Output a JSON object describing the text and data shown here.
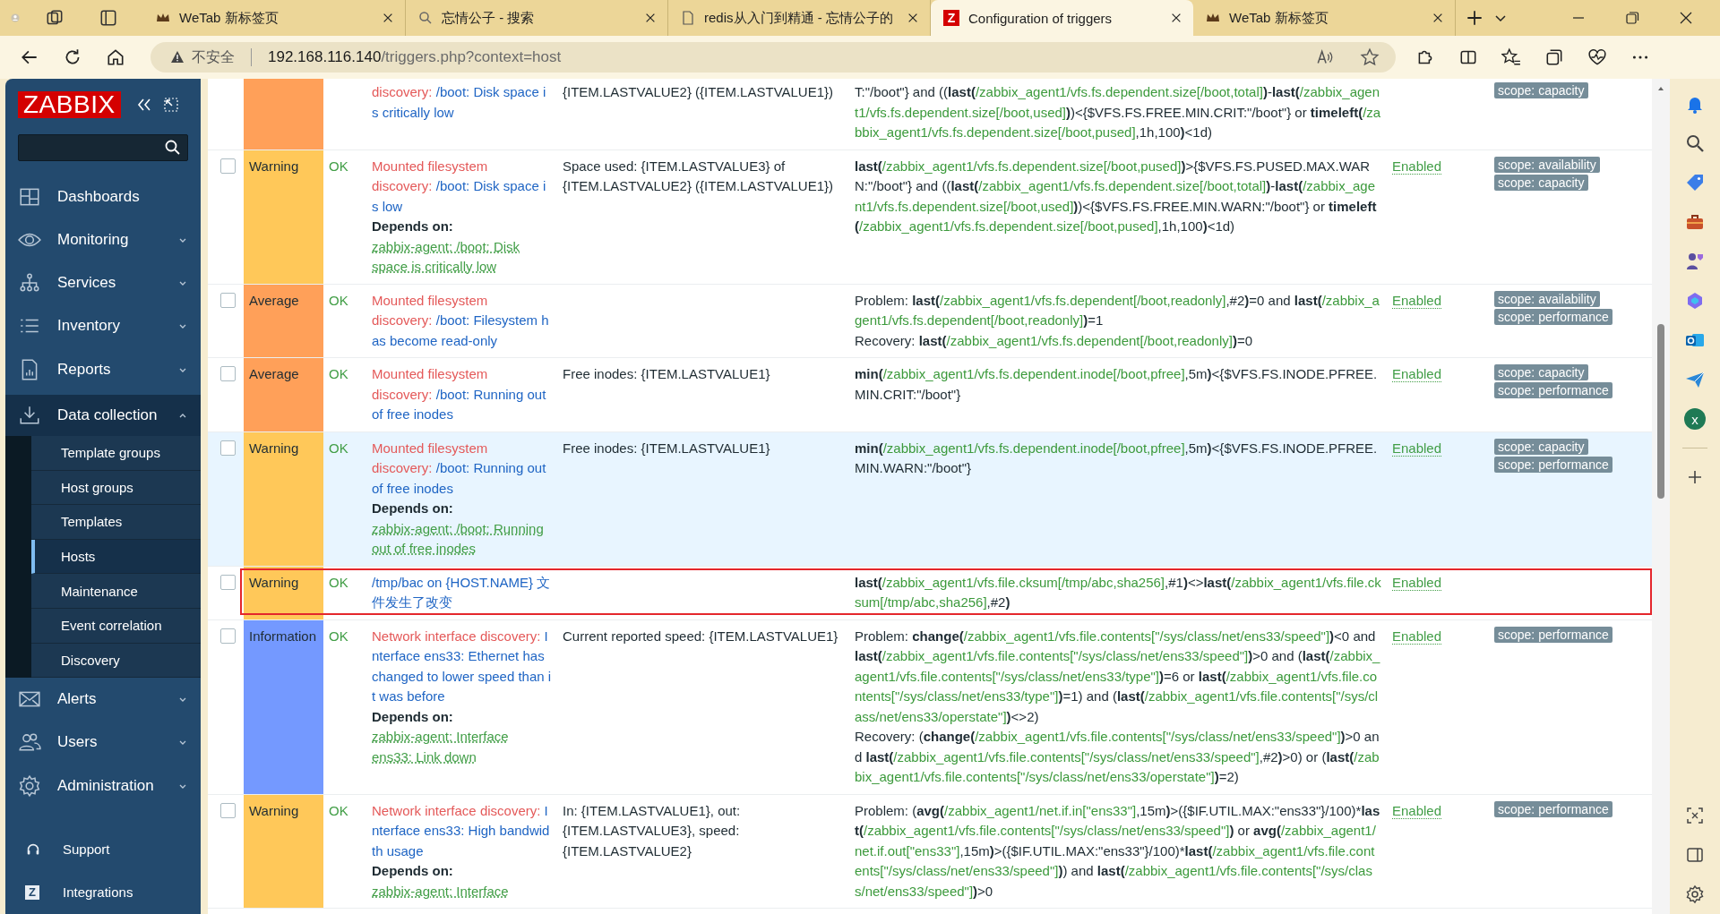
{
  "browser": {
    "tabs": [
      {
        "title": "WeTab 新标签页",
        "selected": false
      },
      {
        "title": "忘情公子 - 搜索",
        "selected": false
      },
      {
        "title": "redis从入门到精通 - 忘情公子的",
        "selected": false
      },
      {
        "title": "Configuration of triggers",
        "icon_letter": "Z",
        "selected": true
      },
      {
        "title": "WeTab 新标签页",
        "selected": false
      }
    ],
    "address": {
      "warning": "不安全",
      "host": "192.168.116.140",
      "path": "/triggers.php?context=host"
    },
    "side_badge": "x"
  },
  "sidebar": {
    "logo": "ZABBIX",
    "items": [
      {
        "label": "Dashboards",
        "kind": "link"
      },
      {
        "label": "Monitoring",
        "kind": "group",
        "expanded": false
      },
      {
        "label": "Services",
        "kind": "group",
        "expanded": false
      },
      {
        "label": "Inventory",
        "kind": "group",
        "expanded": false
      },
      {
        "label": "Reports",
        "kind": "group",
        "expanded": false
      },
      {
        "label": "Data collection",
        "kind": "group",
        "expanded": true,
        "children": [
          {
            "label": "Template groups",
            "selected": false
          },
          {
            "label": "Host groups",
            "selected": false
          },
          {
            "label": "Templates",
            "selected": false
          },
          {
            "label": "Hosts",
            "selected": true
          },
          {
            "label": "Maintenance",
            "selected": false
          },
          {
            "label": "Event correlation",
            "selected": false
          },
          {
            "label": "Discovery",
            "selected": false
          }
        ]
      },
      {
        "label": "Alerts",
        "kind": "group",
        "expanded": false
      },
      {
        "label": "Users",
        "kind": "group",
        "expanded": false
      },
      {
        "label": "Administration",
        "kind": "group",
        "expanded": false
      }
    ],
    "footer_items": [
      {
        "label": "Support"
      },
      {
        "label": "Integrations",
        "icon_letter": "Z"
      }
    ]
  },
  "table": {
    "rows": [
      {
        "color": "#ffa059",
        "highlighted": false,
        "outlined": false,
        "name_prefix": "discovery:",
        "name": "/boot: Disk space is critically low",
        "opdata": "{ITEM.LASTVALUE2} ({ITEM.LASTVALUE1})",
        "expression": [
          [
            {
              "kind": "text",
              "text": "T:\"/boot\"} and (("
            },
            {
              "kind": "fn",
              "text": "last("
            },
            {
              "kind": "item",
              "text": "/zabbix_agent1/vfs.fs.dependent.size[/boot,total]"
            },
            {
              "kind": "fn",
              "text": ")"
            },
            {
              "kind": "text",
              "text": "-"
            },
            {
              "kind": "fn",
              "text": "last("
            },
            {
              "kind": "item",
              "text": "/zabbix_agent1/vfs.fs.dependent.size[/boot,used]"
            },
            {
              "kind": "fn",
              "text": ")"
            },
            {
              "kind": "text",
              "text": ")<{$VFS.FS.FREE.MIN.CRIT:\"/boot\"} or "
            },
            {
              "kind": "fn",
              "text": "timeleft("
            },
            {
              "kind": "item",
              "text": "/zabbix_agent1/vfs.fs.dependent.size[/boot,pused]"
            },
            {
              "kind": "text",
              "text": ",1h,100"
            },
            {
              "kind": "fn",
              "text": ")"
            },
            {
              "kind": "text",
              "text": "<1d)"
            }
          ]
        ],
        "tags": [
          "scope: capacity"
        ]
      },
      {
        "checked": false,
        "color": "#ffc859",
        "severity_label": "Warning",
        "status": "OK",
        "highlighted": false,
        "outlined": false,
        "name_prefix": "Mounted filesystem discovery:",
        "name": "/boot: Disk space is low",
        "depends_label": "Depends on:",
        "depends": [
          "zabbix-agent: /boot: Disk space is critically low"
        ],
        "opdata": "Space used: {ITEM.LASTVALUE3} of {ITEM.LASTVALUE2} ({ITEM.LASTVALUE1})",
        "expression": [
          [
            {
              "kind": "fn",
              "text": "last("
            },
            {
              "kind": "item",
              "text": "/zabbix_agent1/vfs.fs.dependent.size[/boot,pused]"
            },
            {
              "kind": "fn",
              "text": ")"
            },
            {
              "kind": "text",
              "text": ">{$VFS.FS.PUSED.MAX.WARN:\"/boot\"} and (("
            },
            {
              "kind": "fn",
              "text": "last("
            },
            {
              "kind": "item",
              "text": "/zabbix_agent1/vfs.fs.dependent.size[/boot,total]"
            },
            {
              "kind": "fn",
              "text": ")"
            },
            {
              "kind": "text",
              "text": "-"
            },
            {
              "kind": "fn",
              "text": "last("
            },
            {
              "kind": "item",
              "text": "/zabbix_agent1/vfs.fs.dependent.size[/boot,used]"
            },
            {
              "kind": "fn",
              "text": ")"
            },
            {
              "kind": "text",
              "text": ")<{$VFS.FS.FREE.MIN.WARN:\"/boot\"} or "
            },
            {
              "kind": "fn",
              "text": "timeleft("
            },
            {
              "kind": "item",
              "text": "/zabbix_agent1/vfs.fs.dependent.size[/boot,pused]"
            },
            {
              "kind": "text",
              "text": ",1h,100"
            },
            {
              "kind": "fn",
              "text": ")"
            },
            {
              "kind": "text",
              "text": "<1d)"
            }
          ]
        ],
        "state": "Enabled",
        "tags": [
          "scope: availability",
          "scope: capacity"
        ]
      },
      {
        "checked": false,
        "color": "#ffa059",
        "severity_label": "Average",
        "status": "OK",
        "highlighted": false,
        "outlined": false,
        "name_prefix": "Mounted filesystem discovery:",
        "name": "/boot: Filesystem has become read-only",
        "expression": [
          [
            {
              "kind": "text",
              "text": "Problem: "
            },
            {
              "kind": "fn",
              "text": "last("
            },
            {
              "kind": "item",
              "text": "/zabbix_agent1/vfs.fs.dependent[/boot,readonly]"
            },
            {
              "kind": "text",
              "text": ",#2"
            },
            {
              "kind": "fn",
              "text": ")"
            },
            {
              "kind": "text",
              "text": "=0 and "
            },
            {
              "kind": "fn",
              "text": "last("
            },
            {
              "kind": "item",
              "text": "/zabbix_agent1/vfs.fs.dependent[/boot,readonly]"
            },
            {
              "kind": "fn",
              "text": ")"
            },
            {
              "kind": "text",
              "text": "=1"
            }
          ],
          [
            {
              "kind": "text",
              "text": "Recovery: "
            },
            {
              "kind": "fn",
              "text": "last("
            },
            {
              "kind": "item",
              "text": "/zabbix_agent1/vfs.fs.dependent[/boot,readonly]"
            },
            {
              "kind": "fn",
              "text": ")"
            },
            {
              "kind": "text",
              "text": "=0"
            }
          ]
        ],
        "state": "Enabled",
        "tags": [
          "scope: availability",
          "scope: performance"
        ]
      },
      {
        "checked": false,
        "color": "#ffa059",
        "severity_label": "Average",
        "status": "OK",
        "highlighted": false,
        "outlined": false,
        "name_prefix": "Mounted filesystem discovery:",
        "name": "/boot: Running out of free inodes",
        "opdata": "Free inodes: {ITEM.LASTVALUE1}",
        "expression": [
          [
            {
              "kind": "fn",
              "text": "min("
            },
            {
              "kind": "item",
              "text": "/zabbix_agent1/vfs.fs.dependent.inode[/boot,pfree]"
            },
            {
              "kind": "text",
              "text": ",5m"
            },
            {
              "kind": "fn",
              "text": ")"
            },
            {
              "kind": "text",
              "text": "<{$VFS.FS.INODE.PFREE.MIN.CRIT:\"/boot\"}"
            }
          ]
        ],
        "state": "Enabled",
        "tags": [
          "scope: capacity",
          "scope: performance"
        ]
      },
      {
        "checked": false,
        "color": "#ffc859",
        "severity_label": "Warning",
        "status": "OK",
        "highlighted": true,
        "outlined": false,
        "name_prefix": "Mounted filesystem discovery:",
        "name": "/boot: Running out of free inodes",
        "depends_label": "Depends on:",
        "depends": [
          "zabbix-agent: /boot: Running out of free inodes"
        ],
        "opdata": "Free inodes: {ITEM.LASTVALUE1}",
        "expression": [
          [
            {
              "kind": "fn",
              "text": "min("
            },
            {
              "kind": "item",
              "text": "/zabbix_agent1/vfs.fs.dependent.inode[/boot,pfree]"
            },
            {
              "kind": "text",
              "text": ",5m"
            },
            {
              "kind": "fn",
              "text": ")"
            },
            {
              "kind": "text",
              "text": "<{$VFS.FS.INODE.PFREE.MIN.WARN:\"/boot\"}"
            }
          ]
        ],
        "state": "Enabled",
        "tags": [
          "scope: capacity",
          "scope: performance"
        ]
      },
      {
        "checked": false,
        "color": "#ffc859",
        "severity_label": "Warning",
        "status": "OK",
        "highlighted": false,
        "outlined": true,
        "name": "/tmp/bac on {HOST.NAME} 文件发生了改变",
        "expression": [
          [
            {
              "kind": "fn",
              "text": "last("
            },
            {
              "kind": "item",
              "text": "/zabbix_agent1/vfs.file.cksum[/tmp/abc,sha256]"
            },
            {
              "kind": "text",
              "text": ",#1"
            },
            {
              "kind": "fn",
              "text": ")"
            },
            {
              "kind": "text",
              "text": "<>"
            },
            {
              "kind": "fn",
              "text": "last("
            },
            {
              "kind": "item",
              "text": "/zabbix_agent1/vfs.file.cksum[/tmp/abc,sha256]"
            },
            {
              "kind": "text",
              "text": ",#2"
            },
            {
              "kind": "fn",
              "text": ")"
            }
          ]
        ],
        "state": "Enabled",
        "tags": []
      },
      {
        "checked": false,
        "color": "#7499ff",
        "severity_label": "Information",
        "status": "OK",
        "highlighted": false,
        "outlined": false,
        "name_prefix": "Network interface discovery:",
        "name": "Interface ens33: Ethernet has changed to lower speed than it was before",
        "depends_label": "Depends on:",
        "depends": [
          "zabbix-agent: Interface ens33: Link down"
        ],
        "opdata": "Current reported speed: {ITEM.LASTVALUE1}",
        "expression": [
          [
            {
              "kind": "text",
              "text": "Problem: "
            },
            {
              "kind": "fn",
              "text": "change("
            },
            {
              "kind": "item",
              "text": "/zabbix_agent1/vfs.file.contents[\"/sys/class/net/ens33/speed\"]"
            },
            {
              "kind": "fn",
              "text": ")"
            },
            {
              "kind": "text",
              "text": "<0 and "
            },
            {
              "kind": "fn",
              "text": "last("
            },
            {
              "kind": "item",
              "text": "/zabbix_agent1/vfs.file.contents[\"/sys/class/net/ens33/speed\"]"
            },
            {
              "kind": "fn",
              "text": ")"
            },
            {
              "kind": "text",
              "text": ">0 and ("
            },
            {
              "kind": "fn",
              "text": "last("
            },
            {
              "kind": "item",
              "text": "/zabbix_agent1/vfs.file.contents[\"/sys/class/net/ens33/type\"]"
            },
            {
              "kind": "fn",
              "text": ")"
            },
            {
              "kind": "text",
              "text": "=6 or "
            },
            {
              "kind": "fn",
              "text": "last("
            },
            {
              "kind": "item",
              "text": "/zabbix_agent1/vfs.file.contents[\"/sys/class/net/ens33/type\"]"
            },
            {
              "kind": "fn",
              "text": ")"
            },
            {
              "kind": "text",
              "text": "=1) and ("
            },
            {
              "kind": "fn",
              "text": "last("
            },
            {
              "kind": "item",
              "text": "/zabbix_agent1/vfs.file.contents[\"/sys/class/net/ens33/operstate\"]"
            },
            {
              "kind": "fn",
              "text": ")"
            },
            {
              "kind": "text",
              "text": "<>2)"
            }
          ],
          [
            {
              "kind": "text",
              "text": "Recovery: ("
            },
            {
              "kind": "fn",
              "text": "change("
            },
            {
              "kind": "item",
              "text": "/zabbix_agent1/vfs.file.contents[\"/sys/class/net/ens33/speed\"]"
            },
            {
              "kind": "fn",
              "text": ")"
            },
            {
              "kind": "text",
              "text": ">0 and "
            },
            {
              "kind": "fn",
              "text": "last("
            },
            {
              "kind": "item",
              "text": "/zabbix_agent1/vfs.file.contents[\"/sys/class/net/ens33/speed\"]"
            },
            {
              "kind": "text",
              "text": ",#2"
            },
            {
              "kind": "fn",
              "text": ")"
            },
            {
              "kind": "text",
              "text": ">0) or ("
            },
            {
              "kind": "fn",
              "text": "last("
            },
            {
              "kind": "item",
              "text": "/zabbix_agent1/vfs.file.contents[\"/sys/class/net/ens33/operstate\"]"
            },
            {
              "kind": "fn",
              "text": ")"
            },
            {
              "kind": "text",
              "text": "=2)"
            }
          ]
        ],
        "state": "Enabled",
        "tags": [
          "scope: performance"
        ]
      },
      {
        "checked": false,
        "color": "#ffc859",
        "severity_label": "Warning",
        "status": "OK",
        "highlighted": false,
        "outlined": false,
        "name_prefix": "Network interface discovery:",
        "name": "Interface ens33: High bandwidth usage",
        "depends_label": "Depends on:",
        "depends": [
          "zabbix-agent: Interface"
        ],
        "opdata": "In: {ITEM.LASTVALUE1}, out: {ITEM.LASTVALUE3}, speed: {ITEM.LASTVALUE2}",
        "expression": [
          [
            {
              "kind": "text",
              "text": "Problem: ("
            },
            {
              "kind": "fn",
              "text": "avg("
            },
            {
              "kind": "item",
              "text": "/zabbix_agent1/net.if.in[\"ens33\"]"
            },
            {
              "kind": "text",
              "text": ",15m"
            },
            {
              "kind": "fn",
              "text": ")"
            },
            {
              "kind": "text",
              "text": ">({$IF.UTIL.MAX:\"ens33\"}/100)*"
            },
            {
              "kind": "fn",
              "text": "last("
            },
            {
              "kind": "item",
              "text": "/zabbix_agent1/vfs.file.contents[\"/sys/class/net/ens33/speed\"]"
            },
            {
              "kind": "fn",
              "text": ")"
            },
            {
              "kind": "text",
              "text": " or "
            },
            {
              "kind": "fn",
              "text": "avg("
            },
            {
              "kind": "item",
              "text": "/zabbix_agent1/net.if.out[\"ens33\"]"
            },
            {
              "kind": "text",
              "text": ",15m"
            },
            {
              "kind": "fn",
              "text": ")"
            },
            {
              "kind": "text",
              "text": ">({$IF.UTIL.MAX:\"ens33\"}/100)*"
            },
            {
              "kind": "fn",
              "text": "last("
            },
            {
              "kind": "item",
              "text": "/zabbix_agent1/vfs.file.contents[\"/sys/class/net/ens33/speed\"]"
            },
            {
              "kind": "fn",
              "text": ")"
            },
            {
              "kind": "text",
              "text": ") and "
            },
            {
              "kind": "fn",
              "text": "last("
            },
            {
              "kind": "item",
              "text": "/zabbix_agent1/vfs.file.contents[\"/sys/class/net/ens33/speed\"]"
            },
            {
              "kind": "fn",
              "text": ")"
            },
            {
              "kind": "text",
              "text": ">0"
            }
          ]
        ],
        "state": "Enabled",
        "tags": [
          "scope: performance"
        ]
      }
    ]
  }
}
